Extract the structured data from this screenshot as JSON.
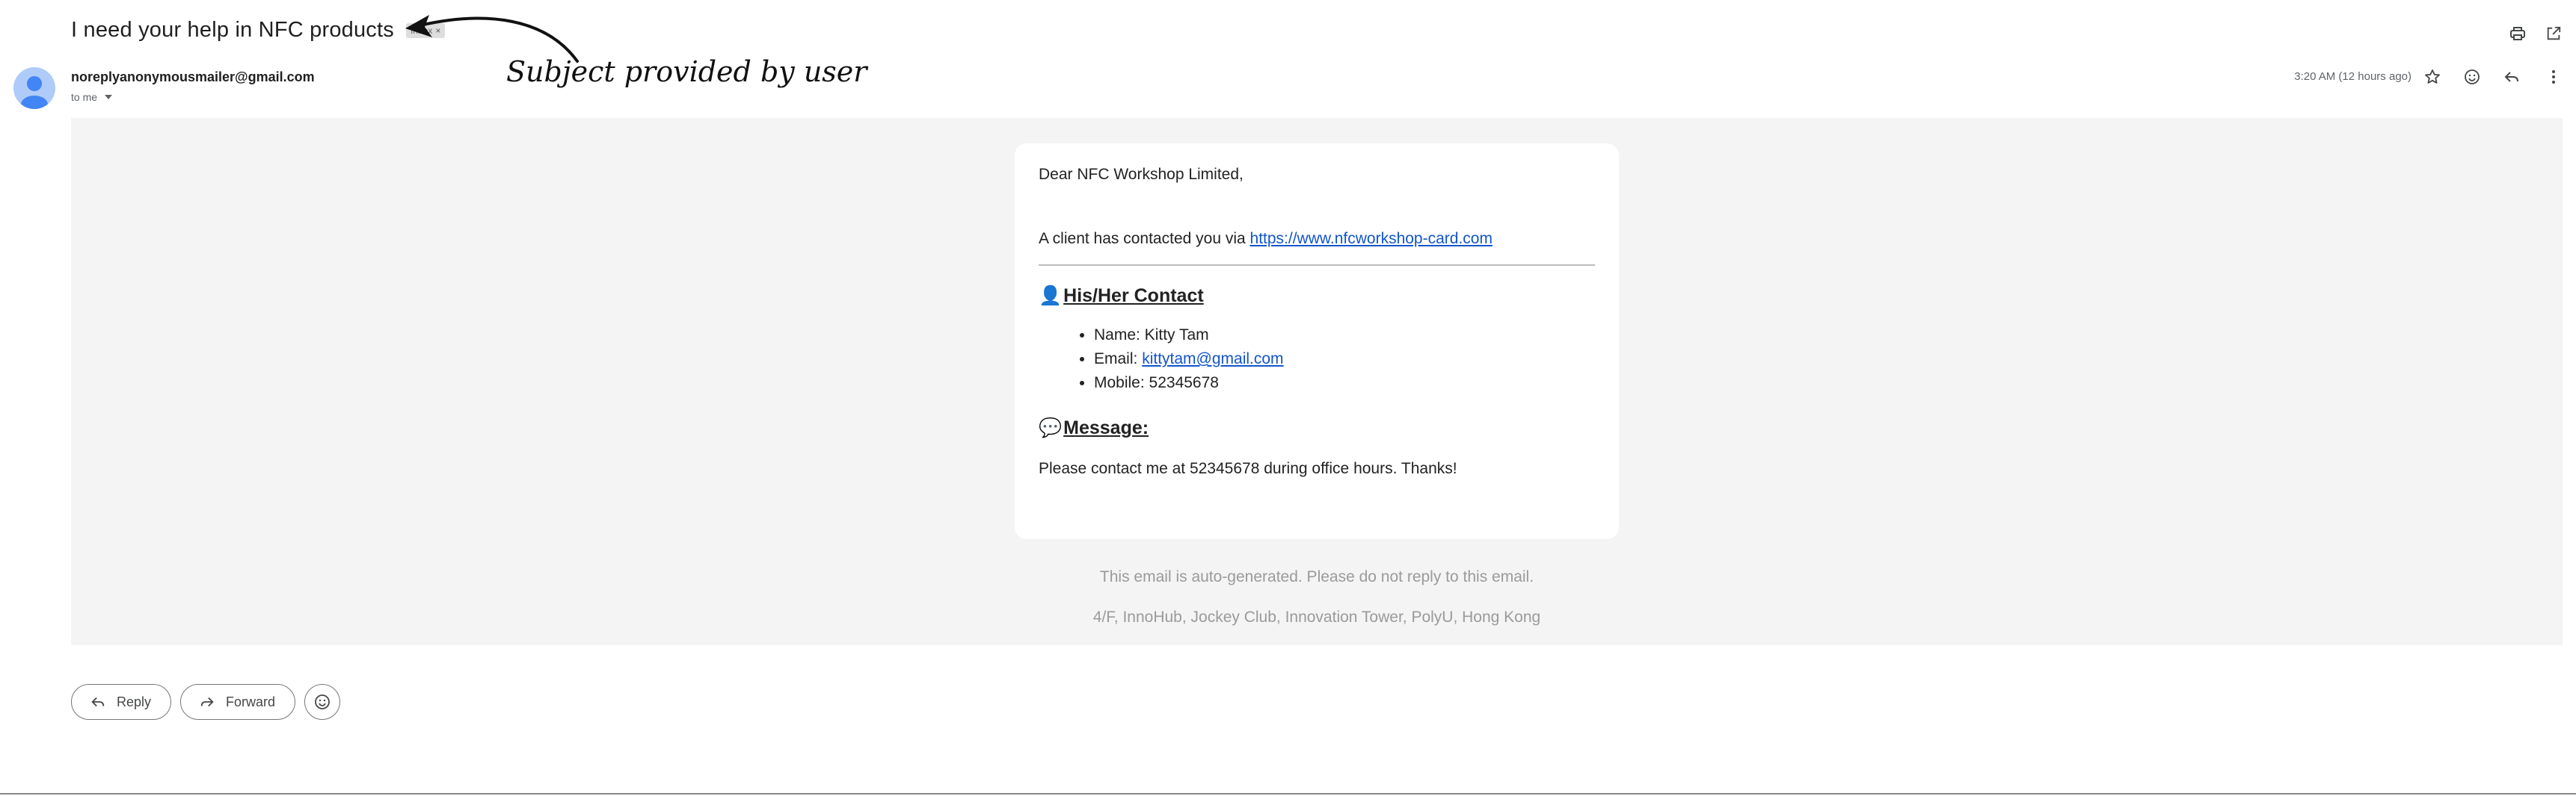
{
  "email": {
    "subject": "I need your help in NFC products",
    "label_chip": "Inbox",
    "label_chip_close": "×",
    "sender": "noreplyanonymousmailer@gmail.com",
    "recipient": "to me",
    "timestamp": "3:20 AM (12 hours ago)"
  },
  "annotation": {
    "text": "Subject provided by user"
  },
  "message": {
    "greeting": "Dear NFC Workshop Limited,",
    "contact_prefix": "A client has contacted you via ",
    "contact_link": "https://www.nfcworkshop-card.com",
    "contact_icon": "👤",
    "contact_heading": "His/Her Contact",
    "contact_items": {
      "name": "Name: Kitty Tam",
      "email_prefix": "Email: ",
      "email_link": "kittytam@gmail.com",
      "mobile": "Mobile: 52345678"
    },
    "message_icon": "💬",
    "message_heading": "Message:",
    "message_text": "Please contact me at 52345678 during office hours. Thanks!"
  },
  "footer": {
    "notice": "This email is auto-generated. Please do not reply to this email.",
    "address": "4/F, InnoHub, Jockey Club, Innovation Tower, PolyU, Hong Kong"
  },
  "actions": {
    "reply": "Reply",
    "forward": "Forward"
  },
  "icons": {
    "print": "print-icon",
    "open_new_window": "open-in-new-window-icon",
    "star": "star-icon",
    "emoji": "emoji-icon",
    "reply": "reply-icon",
    "more": "more-vertical-icon",
    "avatar": "avatar-person-icon",
    "forward": "forward-icon"
  },
  "colors": {
    "link": "#1155cc",
    "avatar_bg": "#aecbfa",
    "avatar_fg": "#4285f4",
    "body_bg": "#f4f4f5"
  }
}
